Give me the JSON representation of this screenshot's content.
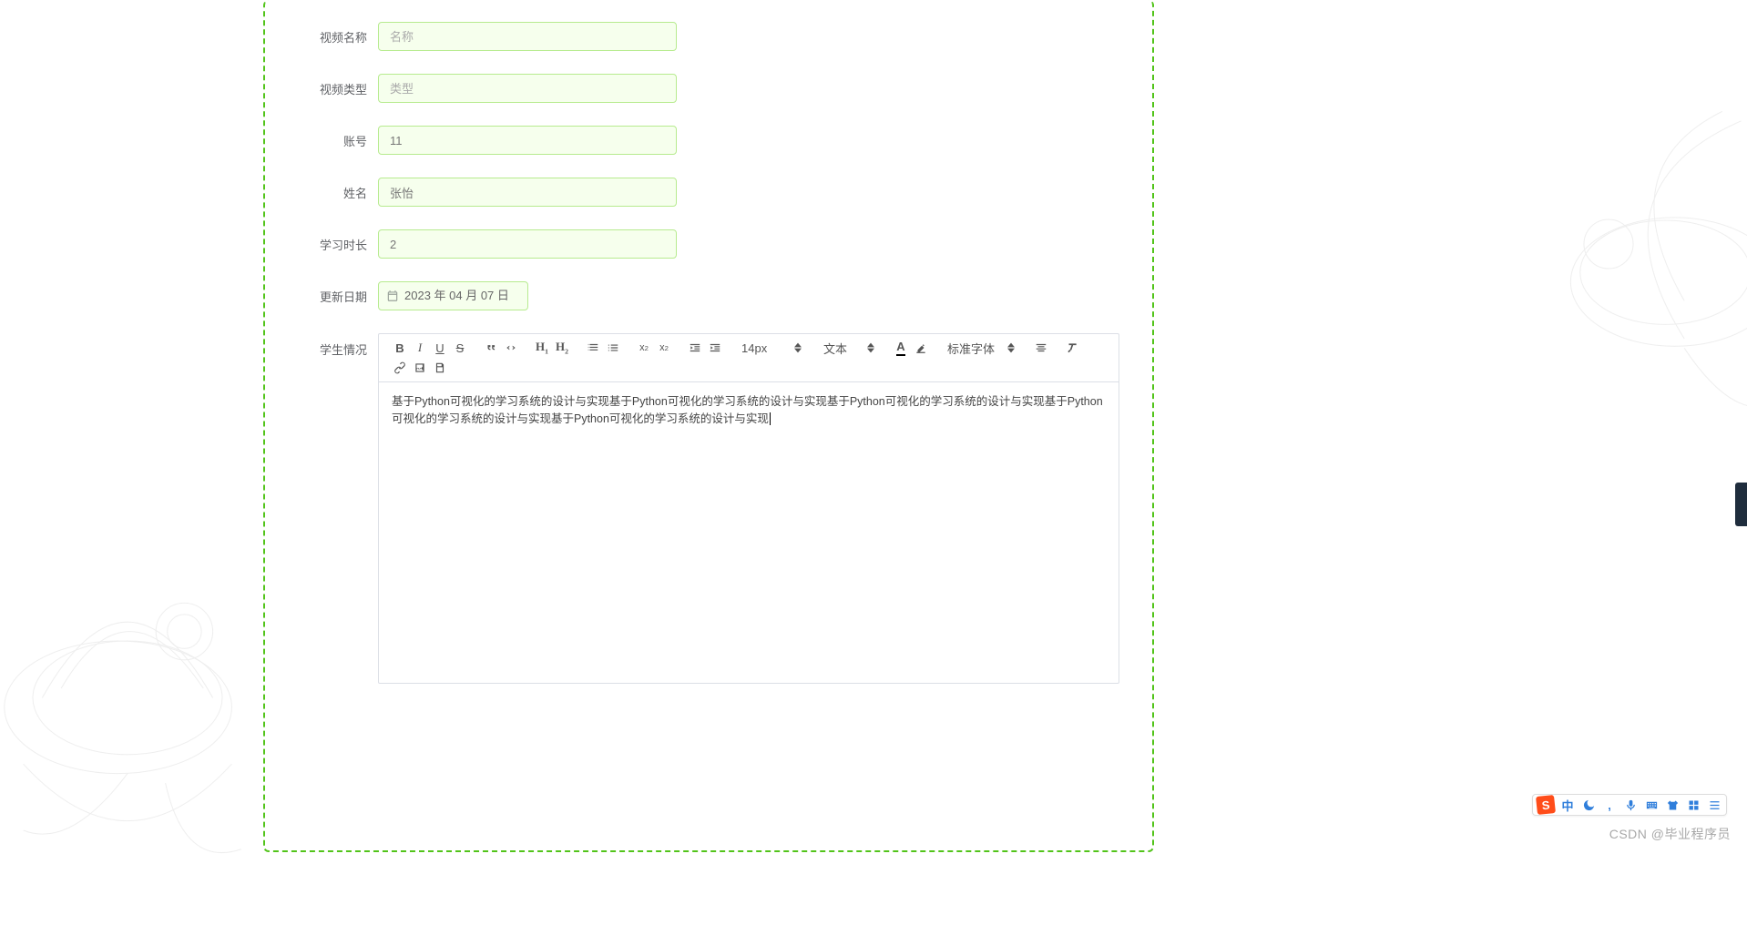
{
  "form": {
    "video_name": {
      "label": "视频名称",
      "placeholder": "名称",
      "value": ""
    },
    "video_type": {
      "label": "视频类型",
      "placeholder": "类型",
      "value": ""
    },
    "account": {
      "label": "账号",
      "value": "11"
    },
    "name": {
      "label": "姓名",
      "value": "张怡"
    },
    "duration": {
      "label": "学习时长",
      "value": "2"
    },
    "update_date": {
      "label": "更新日期",
      "value": "2023 年 04 月 07 日"
    },
    "student_status": {
      "label": "学生情况"
    }
  },
  "toolbar": {
    "size_label": "14px",
    "block_label": "文本",
    "font_label": "标准字体"
  },
  "editor": {
    "content": "基于Python可视化的学习系统的设计与实现基于Python可视化的学习系统的设计与实现基于Python可视化的学习系统的设计与实现基于Python可视化的学习系统的设计与实现基于Python可视化的学习系统的设计与实现"
  },
  "ime": {
    "logo": "S",
    "lang": "中"
  },
  "watermark": "CSDN @毕业程序员"
}
